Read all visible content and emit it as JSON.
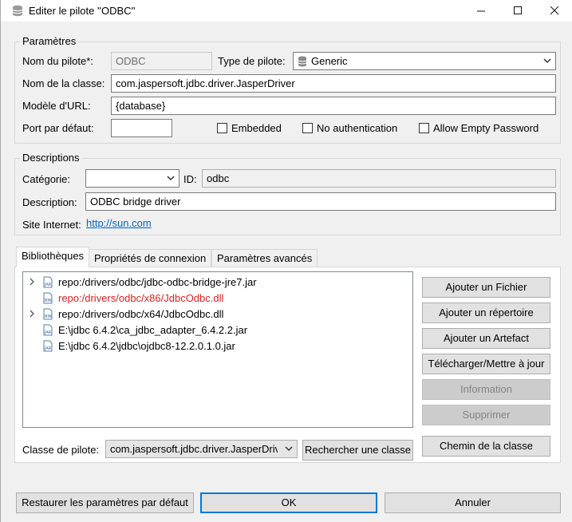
{
  "window": {
    "title": "Editer le pilote ''ODBC''",
    "minimize": "—",
    "maximize": "☐",
    "close": "✕"
  },
  "parametres": {
    "legend": "Paramètres",
    "nom_pilote_label": "Nom du pilote*:",
    "nom_pilote_value": "ODBC",
    "type_pilote_label": "Type de pilote:",
    "type_pilote_value": "Generic",
    "nom_classe_label": "Nom de la classe:",
    "nom_classe_value": "com.jaspersoft.jdbc.driver.JasperDriver",
    "modele_url_label": "Modèle d'URL:",
    "modele_url_value": "{database}",
    "port_label": "Port par défaut:",
    "port_value": "",
    "embedded_label": "Embedded",
    "no_auth_label": "No authentication",
    "allow_empty_label": "Allow Empty Password"
  },
  "descriptions": {
    "legend": "Descriptions",
    "categorie_label": "Catégorie:",
    "categorie_value": "",
    "id_label": "ID:",
    "id_value": "odbc",
    "description_label": "Description:",
    "description_value": "ODBC bridge driver",
    "site_label": "Site Internet:",
    "site_value": "http://sun.com"
  },
  "tabs": [
    {
      "label": "Bibliothèques",
      "active": true
    },
    {
      "label": "Propriétés de connexion",
      "active": false
    },
    {
      "label": "Paramètres avancés",
      "active": false
    }
  ],
  "libraries": [
    {
      "path": "repo:/drivers/odbc/jdbc-odbc-bridge-jre7.jar",
      "expandable": true,
      "icon": "jar-file-icon",
      "error": false
    },
    {
      "path": "repo:/drivers/odbc/x86/JdbcOdbc.dll",
      "expandable": false,
      "icon": "bin-file-icon",
      "error": true
    },
    {
      "path": "repo:/drivers/odbc/x64/JdbcOdbc.dll",
      "expandable": true,
      "icon": "bin-file-icon",
      "error": false
    },
    {
      "path": "E:\\jdbc 6.4.2\\ca_jdbc_adapter_6.4.2.2.jar",
      "expandable": false,
      "icon": "jar-file-icon",
      "error": false
    },
    {
      "path": "E:\\jdbc 6.4.2\\jdbc\\ojdbc8-12.2.0.1.0.jar",
      "expandable": false,
      "icon": "jar-file-icon",
      "error": false
    }
  ],
  "side_buttons": {
    "ajouter_fichier": "Ajouter un Fichier",
    "ajouter_repertoire": "Ajouter un répertoire",
    "ajouter_artefact": "Ajouter un Artefact",
    "telecharger": "Télécharger/Mettre à jour",
    "information": "Information",
    "supprimer": "Supprimer",
    "chemin_classe": "Chemin de la classe"
  },
  "driver_class": {
    "label": "Classe de pilote:",
    "value": "com.jaspersoft.jdbc.driver.JasperDriv",
    "search_button": "Rechercher une classe"
  },
  "footer": {
    "restore": "Restaurer les paramètres par défaut",
    "ok": "OK",
    "cancel": "Annuler"
  },
  "colors": {
    "error_text": "#e02020",
    "link": "#0066cc",
    "focus_border": "#0078d7"
  }
}
